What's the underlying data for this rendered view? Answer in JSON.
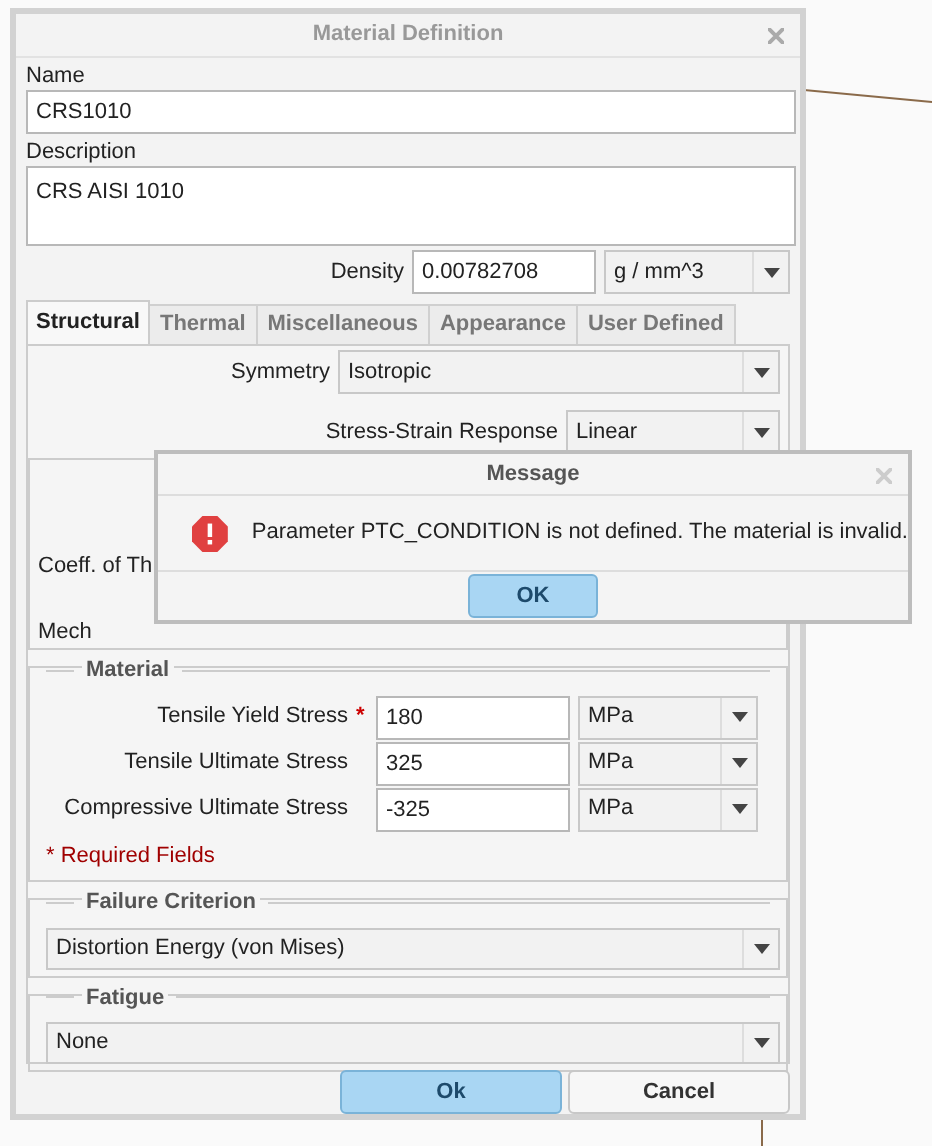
{
  "dialog": {
    "title": "Material Definition",
    "name_label": "Name",
    "name_value": "CRS1010",
    "description_label": "Description",
    "description_value": "CRS AISI 1010",
    "density_label": "Density",
    "density_value": "0.00782708",
    "density_unit": "g / mm^3"
  },
  "tabs": [
    {
      "label": "Structural",
      "selected": true
    },
    {
      "label": "Thermal",
      "selected": false
    },
    {
      "label": "Miscellaneous",
      "selected": false
    },
    {
      "label": "Appearance",
      "selected": false
    },
    {
      "label": "User Defined",
      "selected": false
    }
  ],
  "symmetry": {
    "label": "Symmetry",
    "value": "Isotropic"
  },
  "stress_strain": {
    "label": "Stress-Strain Response",
    "value": "Linear"
  },
  "covered_labels": [
    "Coeff. of Th",
    "Mech"
  ],
  "material_limits": {
    "legend": "Material",
    "rows": [
      {
        "label": "Tensile Yield Stress",
        "marker": "*",
        "value": "180",
        "unit": "MPa"
      },
      {
        "label": "Tensile Ultimate Stress",
        "value": "325",
        "unit": "MPa"
      },
      {
        "label": "Compressive Ultimate Stress",
        "value": "-325",
        "unit": "MPa"
      }
    ],
    "required_note": "* Required Fields"
  },
  "failure_criterion": {
    "legend": "Failure Criterion",
    "value": "Distortion Energy (von Mises)"
  },
  "fatigue": {
    "legend": "Fatigue",
    "value": "None"
  },
  "buttons": [
    {
      "label": "Ok",
      "primary": true
    },
    {
      "label": "Cancel",
      "primary": false
    }
  ],
  "message": {
    "title": "Message",
    "text": "Parameter PTC_CONDITION is not defined. The material is invalid.",
    "button": "OK"
  }
}
